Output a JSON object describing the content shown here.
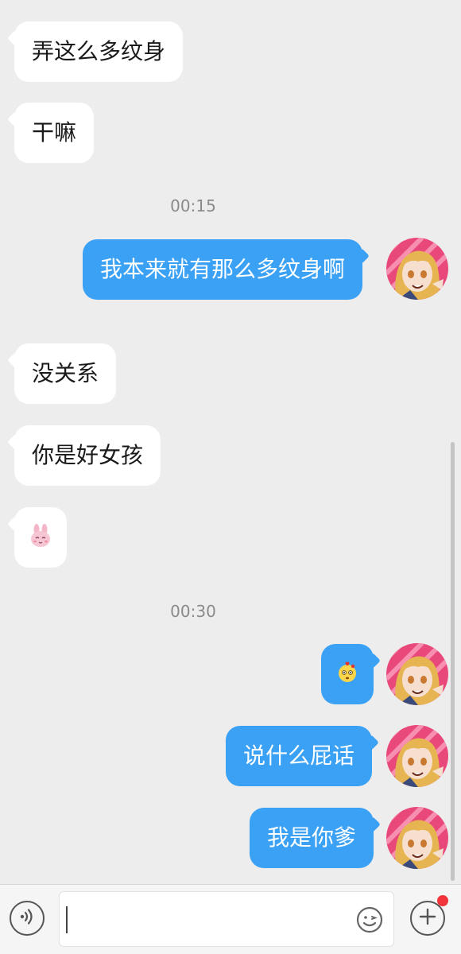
{
  "messages": [
    {
      "side": "in",
      "text": "弄这么多纹身"
    },
    {
      "side": "in",
      "text": "干嘛"
    },
    {
      "side": "out",
      "text": "我本来就有那么多纹身啊"
    },
    {
      "side": "in",
      "text": "没关系"
    },
    {
      "side": "in",
      "text": "你是好女孩"
    },
    {
      "side": "in",
      "sticker": "bunny-sticker-icon"
    },
    {
      "side": "out",
      "sticker": "flushed-face-sticker-icon"
    },
    {
      "side": "out",
      "text": "说什么屁话"
    },
    {
      "side": "out",
      "text": "我是你爹"
    }
  ],
  "timestamps": [
    "00:15",
    "00:30"
  ],
  "input_bar": {
    "voice_icon": "voice-icon",
    "text_value": "",
    "emoji_icon": "emoji-icon",
    "plus_icon": "plus-icon",
    "has_notification_dot": true
  },
  "colors": {
    "background": "#ededed",
    "incoming_bubble": "#ffffff",
    "outgoing_bubble": "#3aa1f5",
    "notification_dot": "#f2353b"
  }
}
